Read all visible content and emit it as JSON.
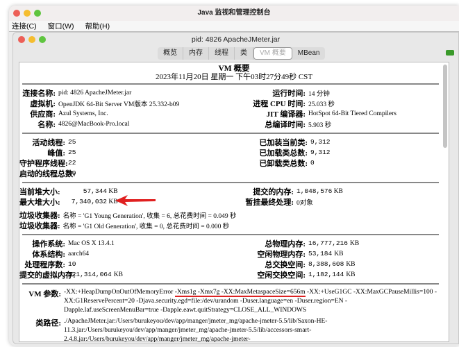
{
  "app_title": "Java 监视和管理控制台",
  "menu": [
    "连接(C)",
    "窗口(W)",
    "帮助(H)"
  ],
  "window_title": "pid: 4826 ApacheJMeter.jar",
  "tabs": [
    "概览",
    "内存",
    "线程",
    "类",
    "VM 概要",
    "MBean"
  ],
  "selected_tab": "VM 概要",
  "summary": {
    "title": "VM 概要",
    "date": "2023年11月20日 星期一 下午03时27分49秒 CST"
  },
  "vm": {
    "left": [
      {
        "l": "连接名称:",
        "v": "pid: 4826 ApacheJMeter.jar"
      },
      {
        "l": "虚拟机:",
        "v": "OpenJDK 64-Bit Server VM版本 25.332-b09"
      },
      {
        "l": "供应商:",
        "v": "Azul Systems, Inc."
      },
      {
        "l": "名称:",
        "v": "4826@MacBook-Pro.local"
      }
    ],
    "right": [
      {
        "l": "运行时间:",
        "v": "14 分钟"
      },
      {
        "l": "进程 CPU 时间:",
        "v": "25.033 秒"
      },
      {
        "l": "JIT 编译器:",
        "v": "HotSpot 64-Bit Tiered Compilers"
      },
      {
        "l": "总编译时间:",
        "v": "5.903 秒"
      }
    ]
  },
  "threads": {
    "left": [
      {
        "l": "活动线程:",
        "v": "25"
      },
      {
        "l": "峰值:",
        "v": "25"
      },
      {
        "l": "守护程序线程:",
        "v": "22"
      },
      {
        "l": "启动的线程总数:",
        "v": "30"
      }
    ],
    "right": [
      {
        "l": "已加装当前类:",
        "v": "9,312"
      },
      {
        "l": "已加载类总数:",
        "v": "9,312"
      },
      {
        "l": "已卸载类总数:",
        "v": "0"
      }
    ]
  },
  "memory": {
    "current_heap": {
      "l": "当前堆大小:",
      "v": "57,344",
      "u": "KB"
    },
    "max_heap": {
      "l": "最大堆大小:",
      "v": "7,340,032",
      "u": "KB"
    },
    "committed": {
      "l": "提交的内存:",
      "v": "1,048,576",
      "u": "KB"
    },
    "pending": {
      "l": "暂挂最终处理:",
      "v": "0对象"
    },
    "gc": [
      {
        "l": "垃圾收集器:",
        "v": "名称 = 'G1 Young Generation', 收集 = 6, 总花费时间 = 0.049 秒"
      },
      {
        "l": "垃圾收集器:",
        "v": "名称 = 'G1 Old Generation', 收集 = 0, 总花费时间 = 0.000 秒"
      }
    ]
  },
  "os": {
    "left": [
      {
        "l": "操作系统:",
        "v": "Mac OS X 13.4.1"
      },
      {
        "l": "体系结构:",
        "v": "aarch64"
      },
      {
        "l": "处理程序数:",
        "v": "10"
      },
      {
        "l": "提交的虚拟内存:",
        "v": "421,314,064",
        "u": "KB"
      }
    ],
    "right": [
      {
        "l": "总物理内存:",
        "v": "16,777,216",
        "u": "KB"
      },
      {
        "l": "空闲物理内存:",
        "v": "53,184",
        "u": "KB"
      },
      {
        "l": "总交换空间:",
        "v": "8,388,608",
        "u": "KB"
      },
      {
        "l": "空闲交换空间:",
        "v": "1,182,144",
        "u": "KB"
      }
    ]
  },
  "args": {
    "vm_label": "VM 参数:",
    "vm_pre": "-XX:+HeapDumpOnOutOfMemoryError ",
    "vm_highlight": "-Xms1g -Xmx7g -XX:MaxMetaspaceSize=656m",
    "vm_post": " -XX:+UseG1GC -XX:MaxGCPauseMillis=100 -XX:G1ReservePercent=20 -Djava.security.egd=file:/dev/urandom -Duser.language=en -Duser.region=EN -Dapple.laf.useScreenMenuBar=true -Dapple.eawt.quitStrategy=CLOSE_ALL_WINDOWS",
    "cp_label": "类路径:",
    "cp": "./ApacheJMeter.jar:/Users/burukeyou/dev/app/manger/jmeter_mg/apache-jmeter-5.5/lib/Saxon-HE-11.3.jar:/Users/burukeyou/dev/app/manger/jmeter_mg/apache-jmeter-5.5/lib/accessors-smart-2.4.8.jar:/Users/burukeyou/dev/app/manger/jmeter_mg/apache-jmeter-"
  },
  "colors": {
    "highlight": "#dd2222",
    "arrow": "#e02020"
  }
}
